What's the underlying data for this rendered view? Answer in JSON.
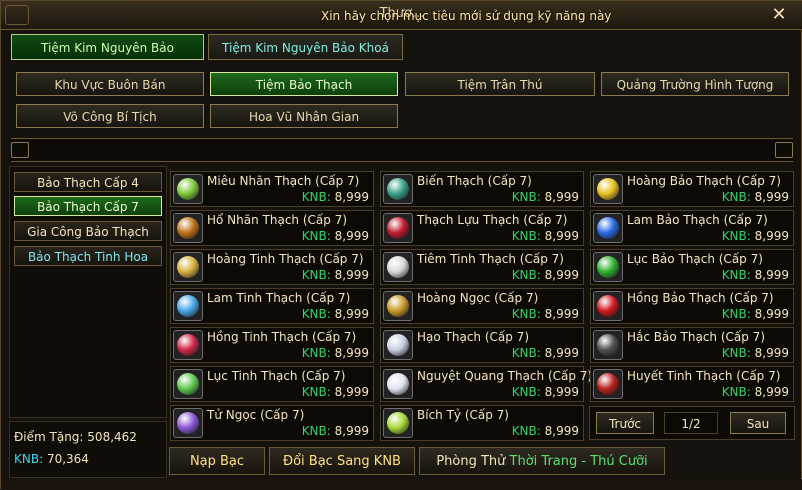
{
  "window": {
    "title": "Thươ...",
    "overlay_text": "Xin hãy chọn mục tiêu mới sử dụng kỹ năng này",
    "close_label": "✕"
  },
  "top_tabs": [
    {
      "label": "Tiệm Kim Nguyên Bảo",
      "active": true
    },
    {
      "label": "Tiệm Kim Nguyên Bảo Khoá",
      "active": false
    }
  ],
  "categories": [
    {
      "label": "Khu Vực Buôn Bán",
      "active": false
    },
    {
      "label": "Tiệm Bảo Thạch",
      "active": true
    },
    {
      "label": "Tiệm Trân Thú",
      "active": false
    },
    {
      "label": "Quảng Trường Hình Tượng",
      "active": false
    },
    {
      "label": "Võ Công Bí Tịch",
      "active": false
    },
    {
      "label": "Hoa Vũ Nhân Gian",
      "active": false
    }
  ],
  "subcategories": [
    {
      "label": "Bảo Thạch Cấp 4",
      "active": false
    },
    {
      "label": "Bảo Thạch Cấp 7",
      "active": true
    },
    {
      "label": "Gia Công Bảo Thạch",
      "active": false
    },
    {
      "label": "Bảo Thạch Tinh Hoa",
      "active": false
    }
  ],
  "stats": {
    "points_label": "Điểm Tặng:",
    "points_value": "508,462",
    "knb_label": "KNB:",
    "knb_value": "70,364"
  },
  "price_label": "KNB:",
  "items": [
    {
      "name": "Miêu Nhãn Thạch (Cấp 7)",
      "price": "8,999",
      "gem_icon": "green-gem-icon",
      "color": "#7ec83a"
    },
    {
      "name": "Biến Thạch (Cấp 7)",
      "price": "8,999",
      "gem_icon": "teal-crystal-icon",
      "color": "#3aa08a"
    },
    {
      "name": "Hoàng Bảo Thạch (Cấp 7)",
      "price": "8,999",
      "gem_icon": "yellow-gem-icon",
      "color": "#e8c020"
    },
    {
      "name": "Hổ Nhãn Thạch (Cấp 7)",
      "price": "8,999",
      "gem_icon": "amber-gem-icon",
      "color": "#c07018"
    },
    {
      "name": "Thạch Lựu Thạch (Cấp 7)",
      "price": "8,999",
      "gem_icon": "red-gem-icon",
      "color": "#c01a30"
    },
    {
      "name": "Lam Bảo Thạch (Cấp 7)",
      "price": "8,999",
      "gem_icon": "blue-gem-icon",
      "color": "#2a6ae0"
    },
    {
      "name": "Hoàng Tinh Thạch (Cấp 7)",
      "price": "8,999",
      "gem_icon": "gold-crystal-icon",
      "color": "#d8b040"
    },
    {
      "name": "Tiêm Tinh Thạch (Cấp 7)",
      "price": "8,999",
      "gem_icon": "white-gem-icon",
      "color": "#d8d8d8"
    },
    {
      "name": "Lục Bảo Thạch (Cấp 7)",
      "price": "8,999",
      "gem_icon": "emerald-gem-icon",
      "color": "#30b030"
    },
    {
      "name": "Lam Tinh Thạch (Cấp 7)",
      "price": "8,999",
      "gem_icon": "cyan-crystal-icon",
      "color": "#48a8e8"
    },
    {
      "name": "Hoàng Ngọc (Cấp 7)",
      "price": "8,999",
      "gem_icon": "topaz-icon",
      "color": "#c89a28"
    },
    {
      "name": "Hồng Bảo Thạch (Cấp 7)",
      "price": "8,999",
      "gem_icon": "ruby-icon",
      "color": "#d01820"
    },
    {
      "name": "Hồng Tinh Thạch (Cấp 7)",
      "price": "8,999",
      "gem_icon": "pink-crystal-icon",
      "color": "#d02848"
    },
    {
      "name": "Hạo Thạch (Cấp 7)",
      "price": "8,999",
      "gem_icon": "diamond-icon",
      "color": "#c8d0e0"
    },
    {
      "name": "Hắc Bảo Thạch (Cấp 7)",
      "price": "8,999",
      "gem_icon": "black-gem-icon",
      "color": "#505050"
    },
    {
      "name": "Lục Tinh Thạch (Cấp 7)",
      "price": "8,999",
      "gem_icon": "green-crystal-icon",
      "color": "#60c850"
    },
    {
      "name": "Nguyệt Quang Thạch (Cấp 7)",
      "price": "8,999",
      "gem_icon": "moonstone-icon",
      "color": "#e0e4f0"
    },
    {
      "name": "Huyết Tinh Thạch (Cấp 7)",
      "price": "8,999",
      "gem_icon": "bloodstone-icon",
      "color": "#b82020"
    },
    {
      "name": "Tử Ngọc (Cấp 7)",
      "price": "8,999",
      "gem_icon": "purple-gem-icon",
      "color": "#8a58d8"
    },
    {
      "name": "Bích Tỷ (Cấp 7)",
      "price": "8,999",
      "gem_icon": "jade-icon",
      "color": "#a8d838"
    }
  ],
  "pagination": {
    "prev_label": "Trước",
    "page": "1/2",
    "next_label": "Sau"
  },
  "bottom_tabs": {
    "recharge_label": "Nạp Bạc",
    "exchange_label": "Đổi Bạc Sang KNB",
    "fitting_prefix": "Phòng Thử",
    "fitting_suffix": "Thời Trang - Thú Cưỡi"
  }
}
